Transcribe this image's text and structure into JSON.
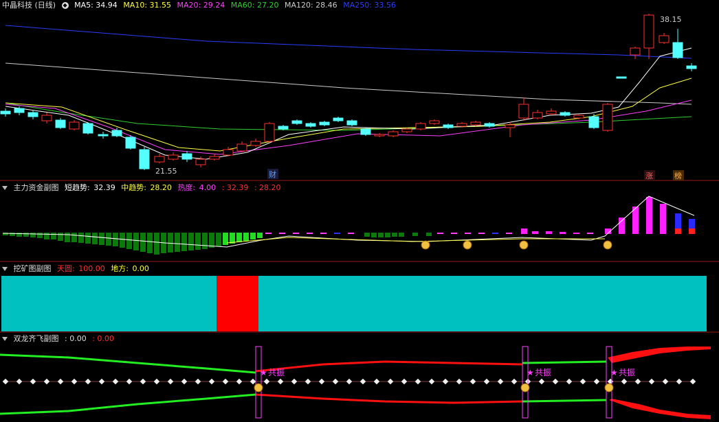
{
  "main": {
    "title": "中晶科技 (日线)",
    "ma5": "MA5: 34.94",
    "ma10": "MA10: 31.55",
    "ma20": "MA20: 29.24",
    "ma60": "MA60: 27.20",
    "ma120": "MA120: 28.46",
    "ma250": "MA250: 33.56",
    "high_label": "38.15",
    "low_label": "21.55",
    "badge_cai": "财",
    "badge_zhang": "涨",
    "badge_bang": "榜"
  },
  "panel2": {
    "title": "主力资金副图",
    "short_label": "短趋势:",
    "short_value": "32.39",
    "mid_label": "中趋势:",
    "mid_value": "28.20",
    "heat_label": "热度:",
    "heat_value": "4.00",
    "extra1": ": 32.39",
    "extra2": ": 28.20"
  },
  "panel3": {
    "title": "挖矿图副图",
    "tian_label": "天圆:",
    "tian_value": "100.00",
    "di_label": "地方:",
    "di_value": "0.00"
  },
  "panel4": {
    "title": "双龙齐飞副图",
    "v1": ": 0.00",
    "v2": ": 0.00",
    "resonance": "共振"
  },
  "colors": {
    "up": "#ff3030",
    "down": "#54ffff",
    "ma5": "#ffffff",
    "ma10": "#ffff40",
    "ma20": "#ff40ff",
    "ma60": "#30d030",
    "ma120": "#cccccc",
    "ma250": "#2a3cff",
    "teal": "#00c0c0",
    "red": "#ff0000"
  }
}
